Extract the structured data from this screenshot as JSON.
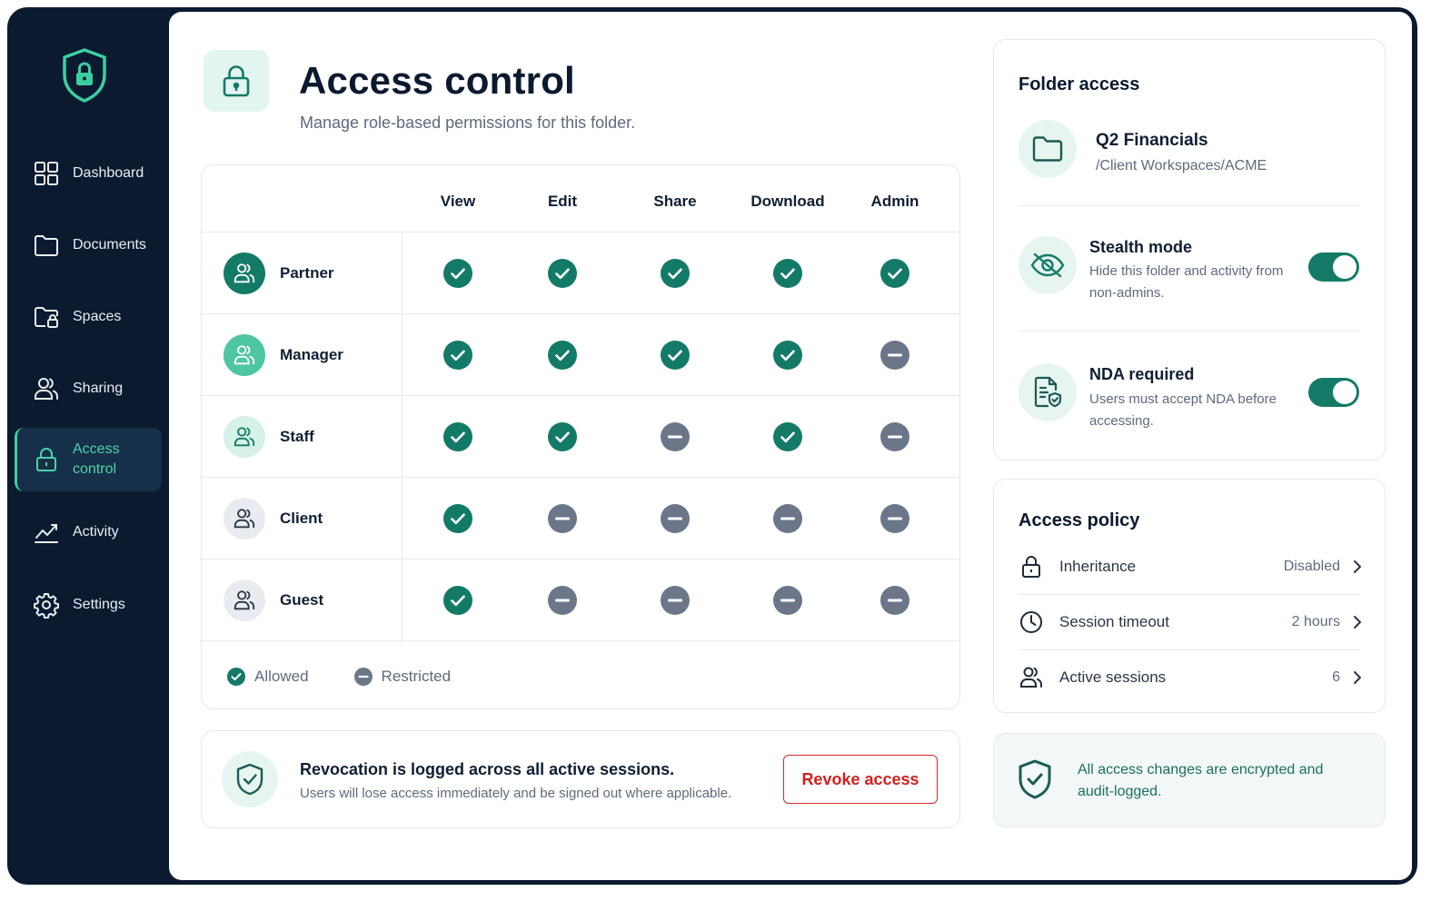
{
  "sidebar": {
    "items": [
      {
        "label": "Dashboard",
        "icon": "grid-icon"
      },
      {
        "label": "Documents",
        "icon": "folder-icon"
      },
      {
        "label": "Spaces",
        "icon": "folder-lock-icon"
      },
      {
        "label": "Sharing",
        "icon": "users-icon"
      },
      {
        "label": "Access\ncontrol",
        "icon": "lock-icon",
        "active": true
      },
      {
        "label": "Activity",
        "icon": "chart-line-icon"
      },
      {
        "label": "Settings",
        "icon": "gear-icon"
      }
    ]
  },
  "header": {
    "title": "Access control",
    "subtitle": "Manage role-based permissions for this folder."
  },
  "permissions": {
    "columns": [
      "View",
      "Edit",
      "Share",
      "Download",
      "Admin"
    ],
    "roles": [
      {
        "name": "Partner",
        "avatar_color": "#147a68",
        "icon_color": "#ffffff",
        "perms": [
          true,
          true,
          true,
          true,
          true
        ]
      },
      {
        "name": "Manager",
        "avatar_color": "#4fc6a2",
        "icon_color": "#ffffff",
        "perms": [
          true,
          true,
          true,
          true,
          false
        ]
      },
      {
        "name": "Staff",
        "avatar_color": "#d6f1e8",
        "icon_color": "#147a68",
        "perms": [
          true,
          true,
          false,
          true,
          false
        ]
      },
      {
        "name": "Client",
        "avatar_color": "#e8ecf1",
        "icon_color": "#2a3647",
        "perms": [
          true,
          false,
          false,
          false,
          false
        ]
      },
      {
        "name": "Guest",
        "avatar_color": "#e8ecf1",
        "icon_color": "#2a3647",
        "perms": [
          true,
          false,
          false,
          false,
          false
        ]
      }
    ],
    "legend": {
      "allowed": "Allowed",
      "restricted": "Restricted"
    },
    "colors": {
      "allowed": "#147a68",
      "restricted": "#6b7789"
    }
  },
  "revocation": {
    "title": "Revocation is logged across all active sessions.",
    "subtitle": "Users will lose access immediately and be signed out where applicable.",
    "button": "Revoke access"
  },
  "folder": {
    "section_title": "Folder access",
    "name": "Q2 Financials",
    "path": "/Client Workspaces/ACME",
    "options": [
      {
        "title": "Stealth mode",
        "description": "Hide this folder and activity from non-admins.",
        "enabled": true
      },
      {
        "title": "NDA required",
        "description": "Users must accept NDA before accessing.",
        "enabled": true
      }
    ]
  },
  "policy": {
    "title": "Access policy",
    "rows": [
      {
        "label": "Inheritance",
        "value": "Disabled",
        "icon": "lock-icon"
      },
      {
        "label": "Session timeout",
        "value": "2 hours",
        "icon": "clock-icon"
      },
      {
        "label": "Active sessions",
        "value": "6",
        "icon": "users-icon"
      }
    ]
  },
  "encryption_note": "All access changes are encrypted and audit-logged.",
  "colors": {
    "accent": "#147a68",
    "sidebar_bg": "#0c1a30",
    "danger": "#d92b2b",
    "active_nav": "#4fd1a9"
  }
}
